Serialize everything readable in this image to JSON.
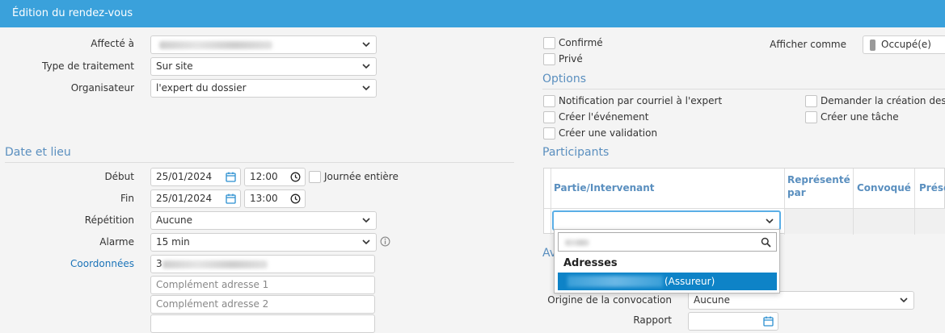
{
  "title": "Édition du rendez-vous",
  "labels": {
    "affecte": "Affecté à",
    "type_traitement": "Type de traitement",
    "organisateur": "Organisateur",
    "debut": "Début",
    "fin": "Fin",
    "repetition": "Répétition",
    "alarme": "Alarme",
    "coordonnees": "Coordonnées",
    "afficher_comme": "Afficher comme",
    "origine": "Origine de la convocation",
    "rapport": "Rapport"
  },
  "values": {
    "type_traitement": "Sur site",
    "organisateur": "l'expert du dossier",
    "debut_date": "25/01/2024",
    "debut_time": "12:00",
    "fin_date": "25/01/2024",
    "fin_time": "13:00",
    "repetition": "Aucune",
    "alarme": "15 min",
    "coordonnees_first": "3",
    "afficher_comme": "Occupé(e)",
    "origine": "Aucune"
  },
  "placeholders": {
    "complement1": "Complément adresse 1",
    "complement2": "Complément adresse 2"
  },
  "checkboxes": {
    "journee_entiere": "Journée entière",
    "confirme": "Confirmé",
    "prive": "Privé",
    "notif": "Notification par courriel à l'expert",
    "creer_evenement": "Créer l'événement",
    "creer_validation": "Créer une validation",
    "demander_creation": "Demander la création des",
    "creer_tache": "Créer une tâche"
  },
  "sections": {
    "date_lieu": "Date et lieu",
    "options": "Options",
    "participants": "Participants",
    "avis_partial": "Av"
  },
  "table": {
    "headers": [
      "Partie/Intervenant",
      "Représenté par",
      "Convoqué",
      "Prése"
    ]
  },
  "dropdown": {
    "group": "Adresses",
    "option_suffix": "(Assureur)"
  },
  "colors": {
    "titlebar": "#3aa1db",
    "section": "#5a8fbf",
    "selected_option": "#0e83c7",
    "link": "#1a73b8"
  }
}
